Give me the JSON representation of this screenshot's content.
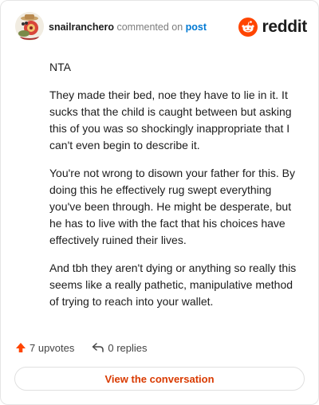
{
  "header": {
    "username": "snailranchero",
    "action": "commented on",
    "target": "post"
  },
  "brand": {
    "wordmark": "reddit",
    "logo_icon": "reddit-alien-icon",
    "accent": "#ff4500"
  },
  "comment": {
    "paragraphs": [
      "NTA",
      "They made their bed, noe they have to lie in it. It sucks that the child is caught between but asking this of you was so shockingly inappropriate that I can't even begin to describe it.",
      "You're not wrong to disown your father for this. By doing this he effectively rug swept everything you've been through. He might be desperate, but he has to live with the fact that his choices have effectively ruined their lives.",
      "And tbh they aren't dying or anything so really this seems like a really pathetic, manipulative method of trying to reach into your wallet."
    ]
  },
  "footer": {
    "upvotes": "7 upvotes",
    "upvote_icon": "upvote-arrow-icon",
    "replies": "0 replies",
    "reply_icon": "reply-arrow-icon"
  },
  "cta": {
    "label": "View the conversation",
    "color": "#d93a00"
  }
}
